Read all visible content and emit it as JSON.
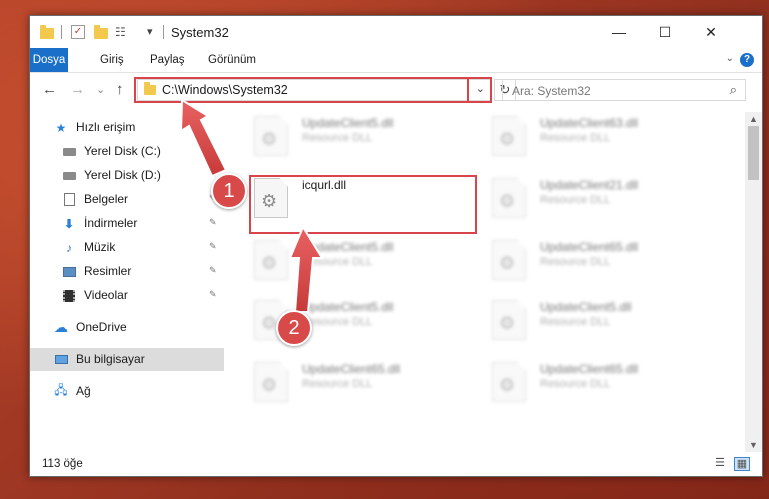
{
  "window": {
    "title": "System32",
    "controls": {
      "minimize": "—",
      "maximize": "☐",
      "close": "✕"
    }
  },
  "quick_access": {
    "dropdown": "▾"
  },
  "ribbon": {
    "tabs": [
      "Dosya",
      "Giriş",
      "Paylaş",
      "Görünüm"
    ],
    "collapse": "⌄",
    "help": "?"
  },
  "nav": {
    "back": "←",
    "forward": "→",
    "recent": "⌄",
    "up": "↑"
  },
  "address": {
    "path": "C:\\Windows\\System32",
    "dropdown": "⌄",
    "refresh": "↻"
  },
  "search": {
    "placeholder": "Ara: System32",
    "icon": "search-icon"
  },
  "sidebar": {
    "items": [
      {
        "label": "Hızlı erişim",
        "icon": "star-icon",
        "pinned": false,
        "selected": false
      },
      {
        "label": "Yerel Disk (C:)",
        "icon": "drive-icon",
        "pinned": true,
        "selected": false
      },
      {
        "label": "Yerel Disk (D:)",
        "icon": "drive-icon",
        "pinned": true,
        "selected": false
      },
      {
        "label": "Belgeler",
        "icon": "documents-icon",
        "pinned": true,
        "selected": false
      },
      {
        "label": "İndirmeler",
        "icon": "download-icon",
        "pinned": true,
        "selected": false
      },
      {
        "label": "Müzik",
        "icon": "music-icon",
        "pinned": true,
        "selected": false
      },
      {
        "label": "Resimler",
        "icon": "pictures-icon",
        "pinned": true,
        "selected": false
      },
      {
        "label": "Videolar",
        "icon": "video-icon",
        "pinned": true,
        "selected": false
      },
      {
        "label": "OneDrive",
        "icon": "cloud-icon",
        "pinned": false,
        "selected": false
      },
      {
        "label": "Bu bilgisayar",
        "icon": "computer-icon",
        "pinned": false,
        "selected": true
      },
      {
        "label": "Ağ",
        "icon": "network-icon",
        "pinned": false,
        "selected": false
      }
    ],
    "pin_glyph": "📌"
  },
  "files": {
    "highlighted": {
      "name": "icqurl.dll",
      "type": ""
    },
    "blurred": [
      {
        "name": "UpdateClient5.dll",
        "type": "Resource DLL"
      },
      {
        "name": "UpdateClient63.dll",
        "type": "Resource DLL"
      },
      {
        "name": "UpdateClient21.dll",
        "type": "Resource DLL"
      },
      {
        "name": "UpdateClient5.dll",
        "type": "Resource DLL"
      },
      {
        "name": "UpdateClient65.dll",
        "type": "Resource DLL"
      },
      {
        "name": "UpdateClient5.dll",
        "type": "Resource DLL"
      },
      {
        "name": "UpdateClient5.dll",
        "type": "Resource DLL"
      },
      {
        "name": "UpdateClient65.dll",
        "type": "Resource DLL"
      },
      {
        "name": "UpdateClient65.dll",
        "type": "Resource DLL"
      }
    ]
  },
  "status": {
    "count": "113 öğe",
    "view_details": "☰",
    "view_large": "▦"
  },
  "callouts": [
    "1",
    "2"
  ],
  "colors": {
    "accent": "#1a6fc9",
    "highlight": "#d9434a",
    "badge": "#d84a4a"
  }
}
